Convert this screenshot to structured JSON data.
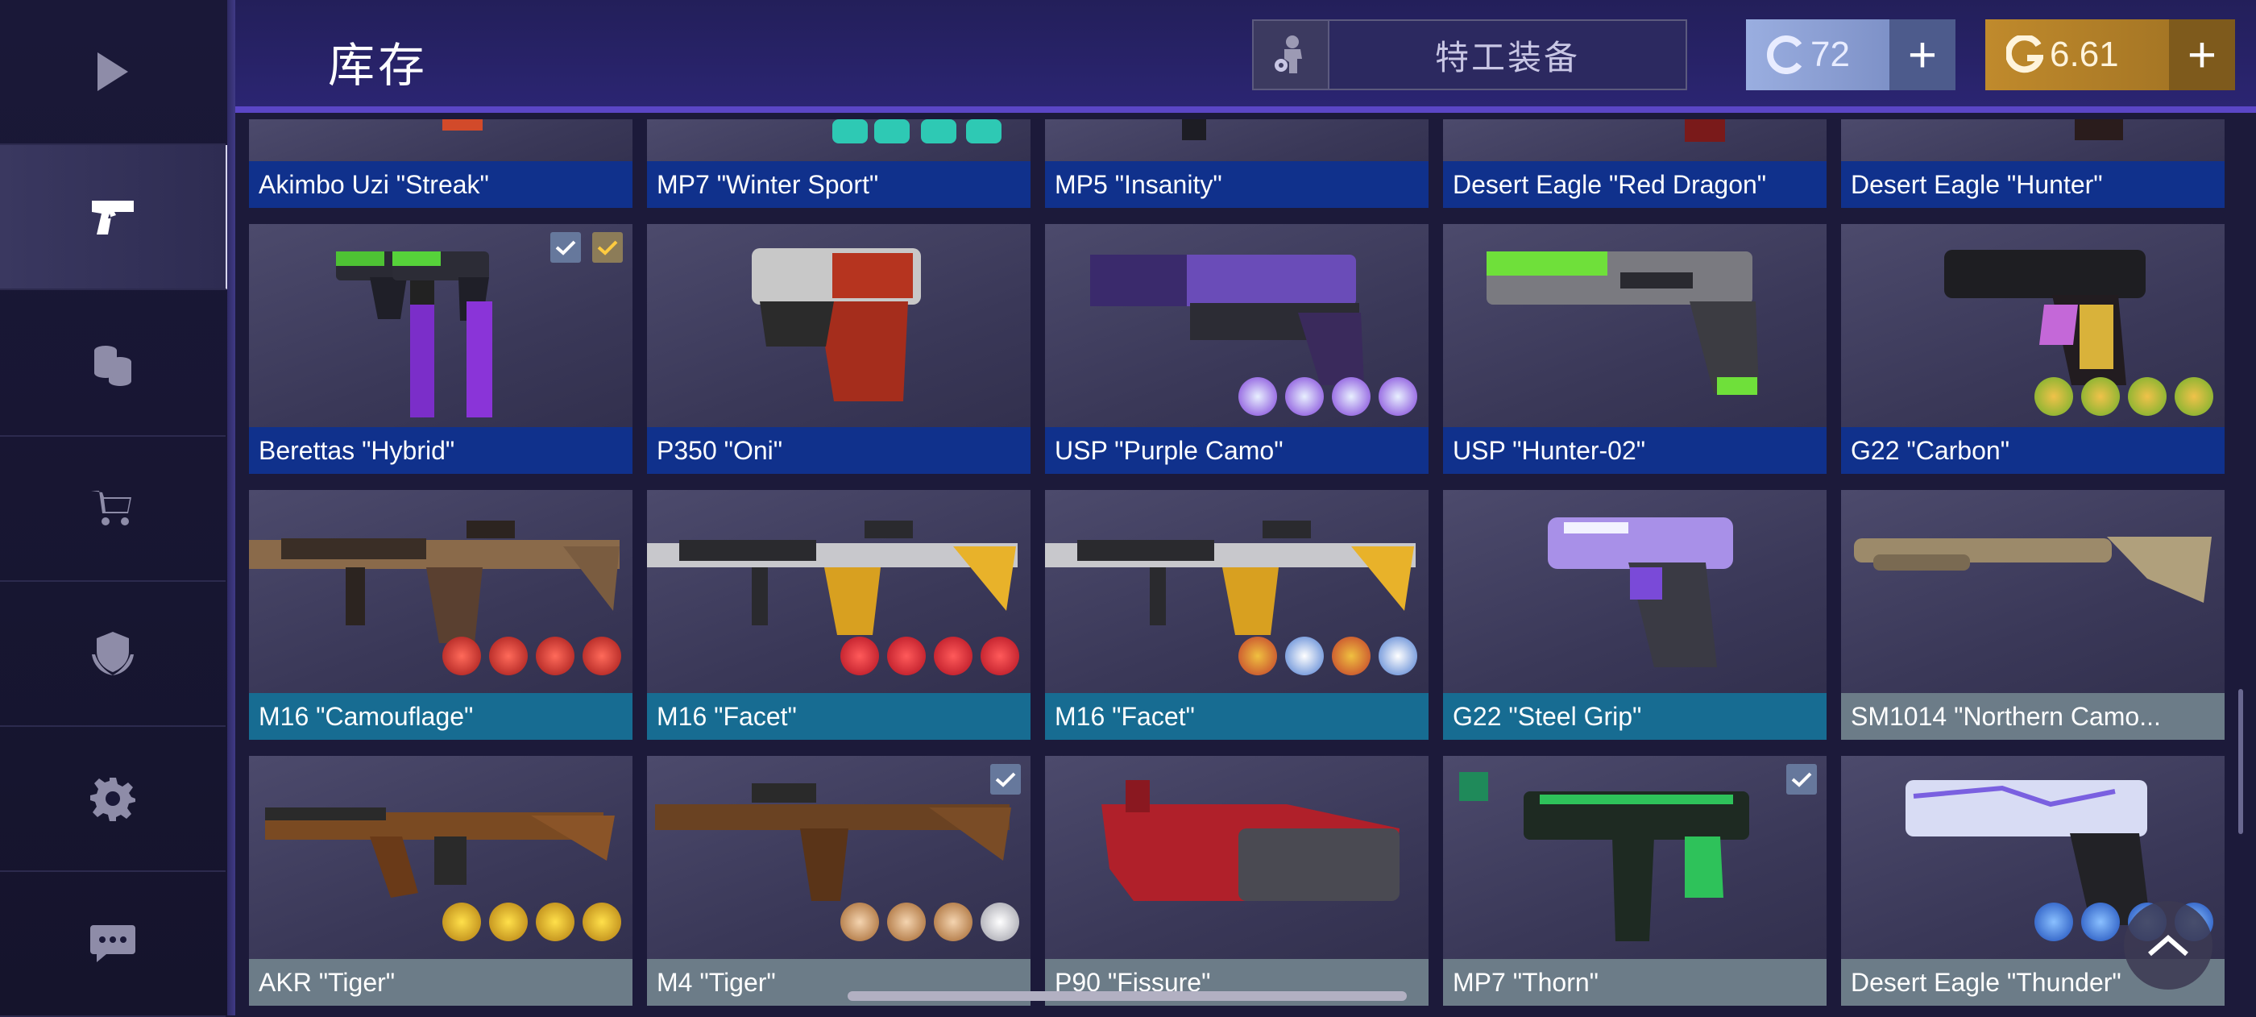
{
  "header": {
    "title": "库存",
    "agent_button": "特工装备",
    "credits": "72",
    "gold": "6.61"
  },
  "sidebar": {
    "items": [
      {
        "name": "play",
        "icon": "play-icon",
        "active": false
      },
      {
        "name": "inventory",
        "icon": "pistol-icon",
        "active": true
      },
      {
        "name": "cases",
        "icon": "coins-icon",
        "active": false
      },
      {
        "name": "market",
        "icon": "cart-icon",
        "active": false
      },
      {
        "name": "clan",
        "icon": "shield-icon",
        "active": false
      },
      {
        "name": "settings",
        "icon": "gear-icon",
        "active": false
      },
      {
        "name": "chat",
        "icon": "chat-icon",
        "active": false
      }
    ]
  },
  "inventory": {
    "rows": [
      [
        {
          "name": "Akimbo Uzi \"Streak\"",
          "rarity": "blue"
        },
        {
          "name": "MP7 \"Winter Sport\"",
          "rarity": "blue"
        },
        {
          "name": "MP5 \"Insanity\"",
          "rarity": "blue"
        },
        {
          "name": "Desert Eagle \"Red Dragon\"",
          "rarity": "blue"
        },
        {
          "name": "Desert Eagle \"Hunter\"",
          "rarity": "blue"
        }
      ],
      [
        {
          "name": "Berettas \"Hybrid\"",
          "rarity": "blue"
        },
        {
          "name": "P350 \"Oni\"",
          "rarity": "blue"
        },
        {
          "name": "USP \"Purple Camo\"",
          "rarity": "blue"
        },
        {
          "name": "USP \"Hunter-02\"",
          "rarity": "blue"
        },
        {
          "name": "G22 \"Carbon\"",
          "rarity": "blue"
        }
      ],
      [
        {
          "name": "M16 \"Camouflage\"",
          "rarity": "teal"
        },
        {
          "name": "M16 \"Facet\"",
          "rarity": "teal"
        },
        {
          "name": "M16 \"Facet\"",
          "rarity": "teal"
        },
        {
          "name": "G22 \"Steel Grip\"",
          "rarity": "teal"
        },
        {
          "name": "SM1014 \"Northern Camo...",
          "rarity": "gray"
        }
      ],
      [
        {
          "name": "AKR \"Tiger\"",
          "rarity": "gray"
        },
        {
          "name": "M4 \"Tiger\"",
          "rarity": "gray"
        },
        {
          "name": "P90 \"Fissure\"",
          "rarity": "gray"
        },
        {
          "name": "MP7 \"Thorn\"",
          "rarity": "gray"
        },
        {
          "name": "Desert Eagle \"Thunder\"",
          "rarity": "gray"
        }
      ]
    ]
  },
  "colors": {
    "rarity_blue": "#10318c",
    "rarity_teal": "#176c92",
    "rarity_gray": "#6c7c88",
    "accent_purple": "#5b46c6",
    "gold": "#c08a2c",
    "credits": "#9aaee0"
  }
}
